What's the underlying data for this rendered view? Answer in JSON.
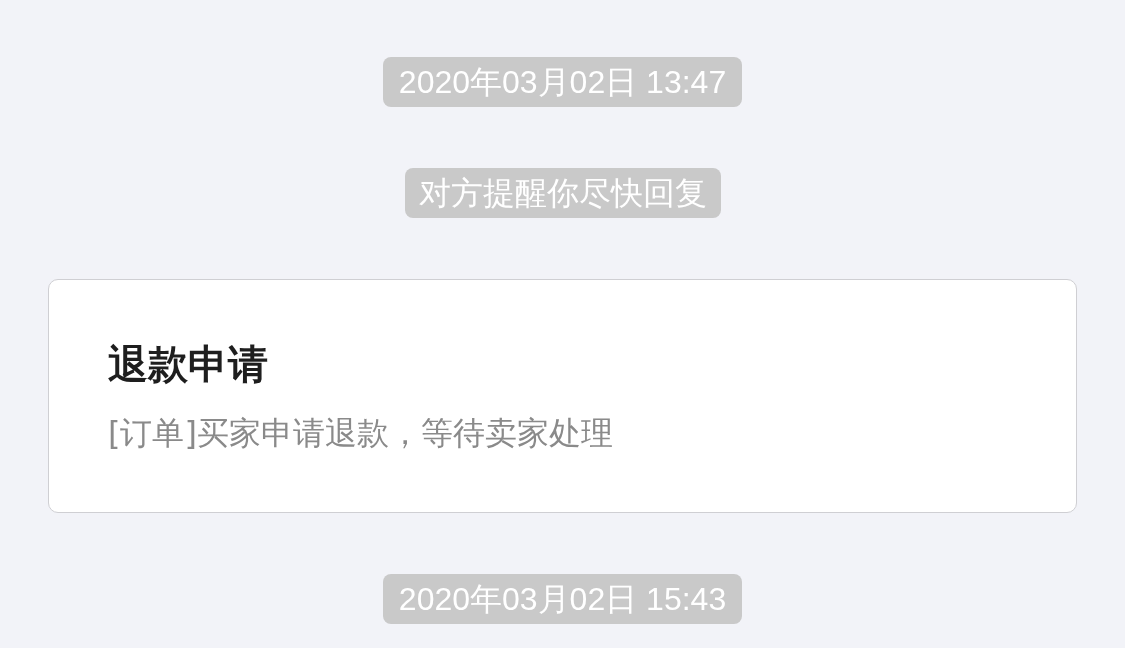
{
  "messages": [
    {
      "kind": "timestamp",
      "text": "2020年03月02日 13:47"
    },
    {
      "kind": "notice",
      "text": "对方提醒你尽快回复"
    },
    {
      "kind": "card",
      "title": "退款申请",
      "description": "[订单]买家申请退款，等待卖家处理"
    },
    {
      "kind": "timestamp",
      "text": "2020年03月02日 15:43"
    }
  ]
}
